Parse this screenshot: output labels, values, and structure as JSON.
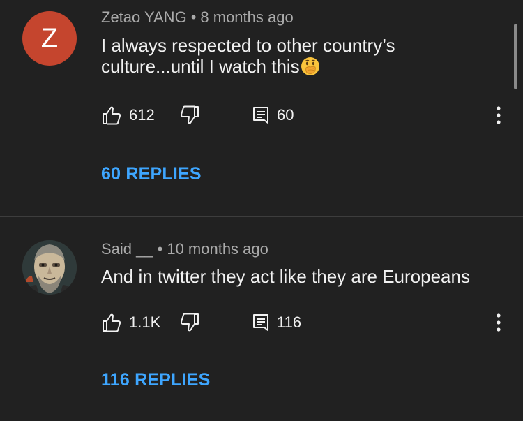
{
  "comments": [
    {
      "avatar_letter": "Z",
      "author": "Zetao YANG",
      "separator": "•",
      "time": "8 months ago",
      "text": "I always respected to other country’s culture...until I watch this",
      "emoji": "face-with-hand-over-mouth",
      "likes": "612",
      "reply_count": "60",
      "replies_link": "60 REPLIES",
      "avatar_color": "#c5452e"
    },
    {
      "author": "Said __",
      "separator": "•",
      "time": "10 months ago",
      "text": "And in twitter they act like they are Europeans",
      "likes": "1.1K",
      "reply_count": "116",
      "replies_link": "116 REPLIES"
    }
  ],
  "colors": {
    "background": "#212121",
    "link": "#3ea6ff",
    "meta": "#aaaaaa",
    "text": "#f1f1f1"
  },
  "icons": [
    "thumbs-up-icon",
    "thumbs-down-icon",
    "reply-icon",
    "more-vert-icon"
  ]
}
